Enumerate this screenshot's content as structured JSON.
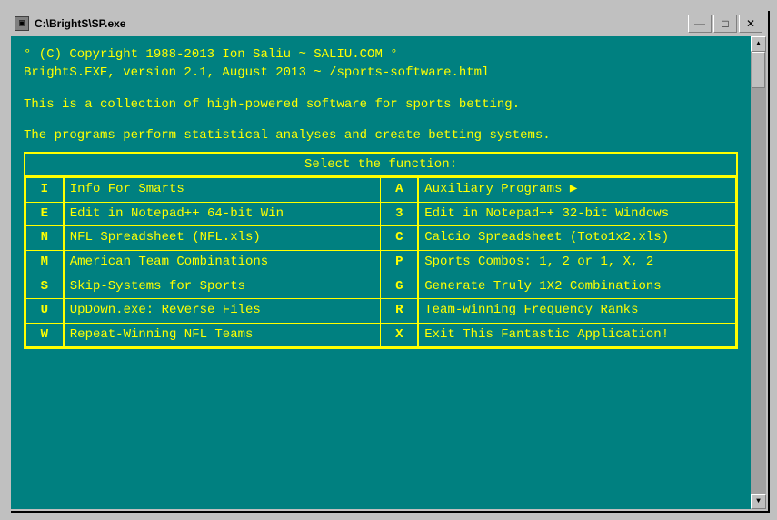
{
  "window": {
    "title": "C:\\BrightS\\SP.exe",
    "title_icon": "▣"
  },
  "title_controls": {
    "minimize": "—",
    "maximize": "□",
    "close": "✕"
  },
  "terminal": {
    "line1": "° (C) Copyright 1988-2013 Ion Saliu ~ SALIU.COM °",
    "line2": "BrightS.EXE, version 2.1, August 2013 ~ /sports-software.html",
    "line3": "",
    "line4": "This is a collection of high-powered software for sports betting.",
    "line5": "",
    "line6": "The programs perform statistical analyses and create betting systems."
  },
  "menu": {
    "header": "Select the function:",
    "rows": [
      {
        "key1": "I",
        "label1": "Info For Smarts",
        "key2": "A",
        "label2": "Auxiliary Programs ▶"
      },
      {
        "key1": "E",
        "label1": "Edit in Notepad++ 64-bit Win",
        "key2": "3",
        "label2": "Edit in Notepad++ 32-bit Windows"
      },
      {
        "key1": "N",
        "label1": "NFL Spreadsheet (NFL.xls)",
        "key2": "C",
        "label2": "Calcio Spreadsheet (Toto1x2.xls)"
      },
      {
        "key1": "M",
        "label1": "American Team Combinations",
        "key2": "P",
        "label2": "Sports Combos:  1, 2 or 1, X, 2"
      },
      {
        "key1": "S",
        "label1": "Skip-Systems for Sports",
        "key2": "G",
        "label2": "Generate Truly 1X2 Combinations"
      },
      {
        "key1": "U",
        "label1": "UpDown.exe: Reverse Files",
        "key2": "R",
        "label2": "Team-winning Frequency Ranks"
      },
      {
        "key1": "W",
        "label1": "Repeat-Winning NFL Teams",
        "key2": "X",
        "label2": "Exit This Fantastic Application!"
      }
    ]
  },
  "scrollbar": {
    "up_arrow": "▲",
    "down_arrow": "▼"
  }
}
